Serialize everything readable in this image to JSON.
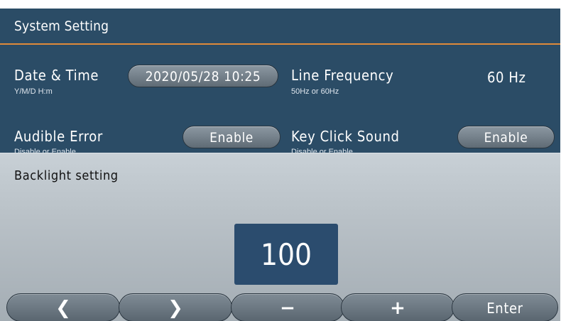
{
  "system_setting": {
    "title": "System Setting",
    "accent_color": "#e08a3a",
    "background_color": "#2b4c66",
    "items": {
      "date_time": {
        "label": "Date & Time",
        "hint": "Y/M/D H:m",
        "value": "2020/05/28 10:25"
      },
      "line_frequency": {
        "label": "Line Frequency",
        "hint": "50Hz or 60Hz",
        "value": "60 Hz"
      },
      "audible_error": {
        "label": "Audible Error",
        "hint": "Disable or Enable",
        "value": "Enable"
      },
      "key_click_sound": {
        "label": "Key Click Sound",
        "hint": "Disable or Enable",
        "value": "Enable"
      }
    }
  },
  "backlight_dialog": {
    "title": "Backlight setting",
    "value": "100",
    "value_box_color": "#2b4c6e"
  },
  "buttons": {
    "left_icon": "chevron-left-icon",
    "left": "❮",
    "right_icon": "chevron-right-icon",
    "right": "❯",
    "minus_icon": "minus-icon",
    "minus": "−",
    "plus_icon": "plus-icon",
    "plus": "+",
    "enter": "Enter"
  }
}
